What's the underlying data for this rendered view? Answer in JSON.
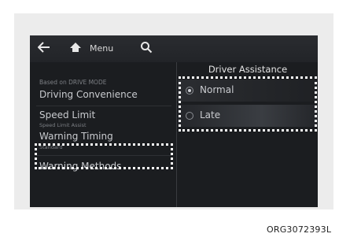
{
  "header": {
    "menu_label": "Menu"
  },
  "right_panel": {
    "title": "Driver Assistance",
    "options": [
      {
        "label": "Normal",
        "selected": true
      },
      {
        "label": "Late",
        "selected": false
      }
    ]
  },
  "left_panel": {
    "section_header": "Based on DRIVE MODE",
    "items": [
      {
        "label": "Driving Convenience",
        "sub": ""
      },
      {
        "label": "Speed Limit",
        "sub": "Speed Limit Assist"
      },
      {
        "label": "Warning Timing",
        "sub": "Standard"
      },
      {
        "label": "Warning Methods",
        "sub": ""
      }
    ]
  },
  "caption": "ORG3072393L",
  "icons": {
    "back": "back-arrow-icon",
    "home": "home-icon",
    "search": "search-icon"
  },
  "colors": {
    "screen_bg": "#1b1d20",
    "highlight": "#ffffff"
  }
}
